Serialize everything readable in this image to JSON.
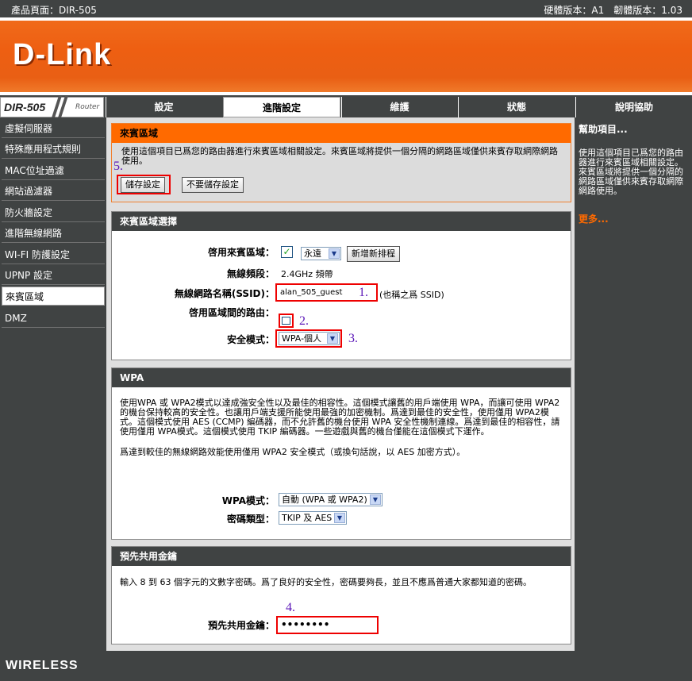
{
  "topbar": {
    "product": "產品頁面：DIR-505",
    "versions": "硬體版本：A1　韌體版本：1.03"
  },
  "header": {
    "logo": "D-Link"
  },
  "nav": {
    "model": "DIR-505",
    "router": "Router",
    "tabs": [
      "設定",
      "進階設定",
      "維護",
      "狀態",
      "說明協助"
    ],
    "active_tab": "進階設定"
  },
  "sidebar": {
    "items": [
      "虛擬伺服器",
      "特殊應用程式規則",
      "MAC位址過濾",
      "網站過濾器",
      "防火牆設定",
      "進階無線網路",
      "WI-FI 防護設定",
      "UPNP 設定",
      "來賓區域",
      "DMZ"
    ],
    "active": "來賓區域"
  },
  "help": {
    "title": "幫助項目...",
    "text": "使用這個項目已爲您的路由器進行來賓區域相關設定。來賓區域將提供一個分隔的網路區域僅供來賓存取網際網路使用。",
    "more": "更多..."
  },
  "guest": {
    "title": "來賓區域",
    "desc": "使用這個項目已爲您的路由器進行來賓區域相關設定。來賓區域將提供一個分隔的網路區域僅供來賓存取網際網路使用。",
    "save": "儲存設定",
    "dont_save": "不要儲存設定"
  },
  "select": {
    "title": "來賓區域選擇",
    "enable_label": "啓用來賓區域：",
    "schedule": "永遠",
    "new_schedule": "新增新排程",
    "band_label": "無線頻段：",
    "band": "2.4GHz 頻帶",
    "ssid_label": "無線網路名稱(SSID)：",
    "ssid": "alan_505_guest",
    "ssid_note": "(也稱之爲 SSID)",
    "routing_label": "啓用區域間的路由：",
    "security_label": "安全模式：",
    "security": "WPA-個人"
  },
  "wpa": {
    "title": "WPA",
    "desc": "使用WPA 或 WPA2模式以達成強安全性以及最佳的相容性。這個模式讓舊的用戶端使用 WPA，而讓可使用 WPA2 的機台保持較高的安全性。也讓用戶端支援所能使用最強的加密機制。爲達到最佳的安全性，使用僅用 WPA2模式。這個模式使用 AES (CCMP) 編碼器，而不允許舊的機台使用 WPA 安全性機制連線。爲達到最佳的相容性，請使用僅用 WPA模式。這個模式使用 TKIP 編碼器。一些遊戲與舊的機台僅能在這個模式下運作。",
    "desc2": "爲達到較佳的無線網路效能使用僅用 WPA2 安全模式（或換句話說，以 AES 加密方式）。",
    "mode_label": "WPA模式：",
    "mode": "自動 (WPA 或 WPA2)",
    "cipher_label": "密碼類型：",
    "cipher": "TKIP 及 AES"
  },
  "psk": {
    "title": "預先共用金鑰",
    "desc": "輸入 8 到 63 個字元的文數字密碼。爲了良好的安全性，密碼要夠長，並且不應爲普通大家都知道的密碼。",
    "label": "預先共用金鑰：",
    "value": "••••••••"
  },
  "annotations": [
    "5.",
    "1.",
    "2.",
    "3.",
    "4."
  ],
  "footer": {
    "brand": "WIRELESS"
  }
}
